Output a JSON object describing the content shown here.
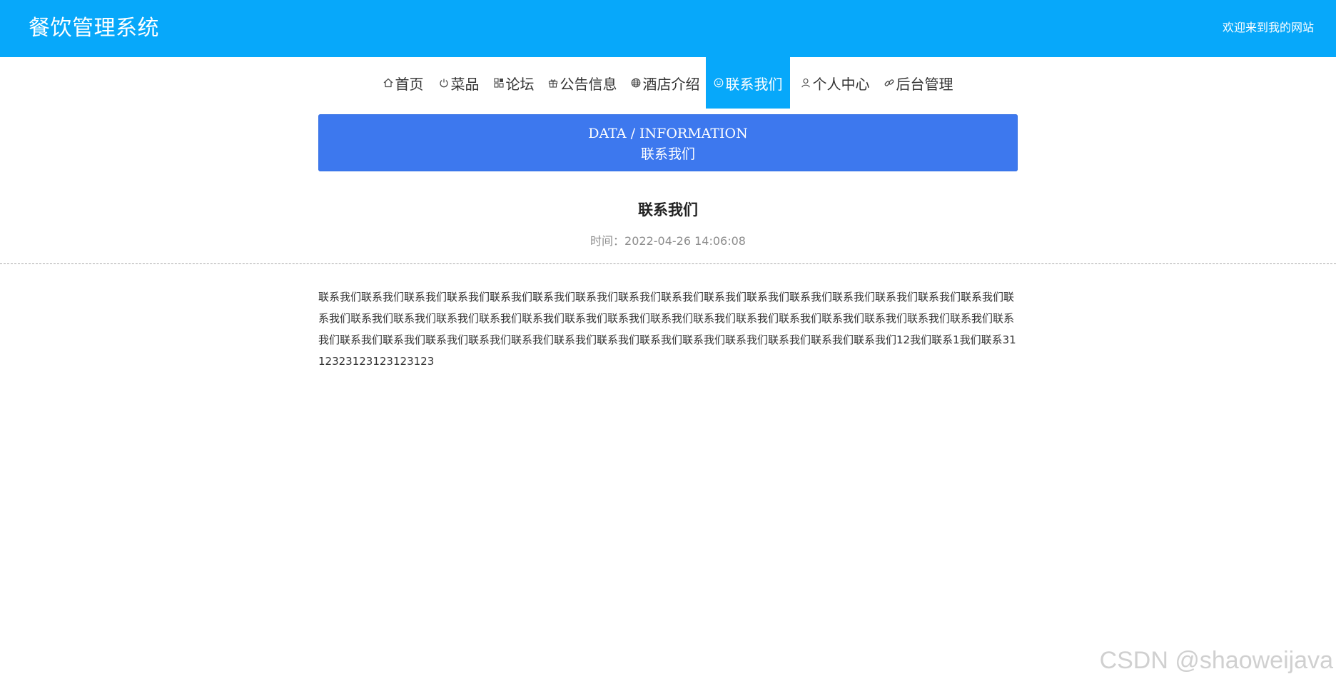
{
  "header": {
    "title": "餐饮管理系统",
    "welcome": "欢迎来到我的网站",
    "background_color": "#07a8fa"
  },
  "nav": {
    "items": [
      {
        "label": "首页",
        "icon": "home-icon"
      },
      {
        "label": "菜品",
        "icon": "power-icon"
      },
      {
        "label": "论坛",
        "icon": "grid-icon"
      },
      {
        "label": "公告信息",
        "icon": "gift-icon"
      },
      {
        "label": "酒店介绍",
        "icon": "globe-icon"
      },
      {
        "label": "联系我们",
        "icon": "smile-icon",
        "active": true
      },
      {
        "label": "个人中心",
        "icon": "user-icon"
      },
      {
        "label": "后台管理",
        "icon": "link-icon"
      }
    ]
  },
  "banner": {
    "subtitle_en": "DATA / INFORMATION",
    "title_cn": "联系我们",
    "background_color": "#3d78ee"
  },
  "article": {
    "title": "联系我们",
    "time_label": "时间：",
    "time_value": "2022-04-26 14:06:08",
    "body": "联系我们联系我们联系我们联系我们联系我们联系我们联系我们联系我们联系我们联系我们联系我们联系我们联系我们联系我们联系我们联系我们联系我们联系我们联系我们联系我们联系我们联系我们联系我们联系我们联系我们联系我们联系我们联系我们联系我们联系我们联系我们联系我们联系我们联系我们联系我们联系我们联系我们联系我们联系我们联系我们联系我们联系我们联系我们联系我们联系我们联系我们12我们联系1我们联系3112323123123123123"
  },
  "watermark": {
    "text": "CSDN @shaoweijava"
  }
}
